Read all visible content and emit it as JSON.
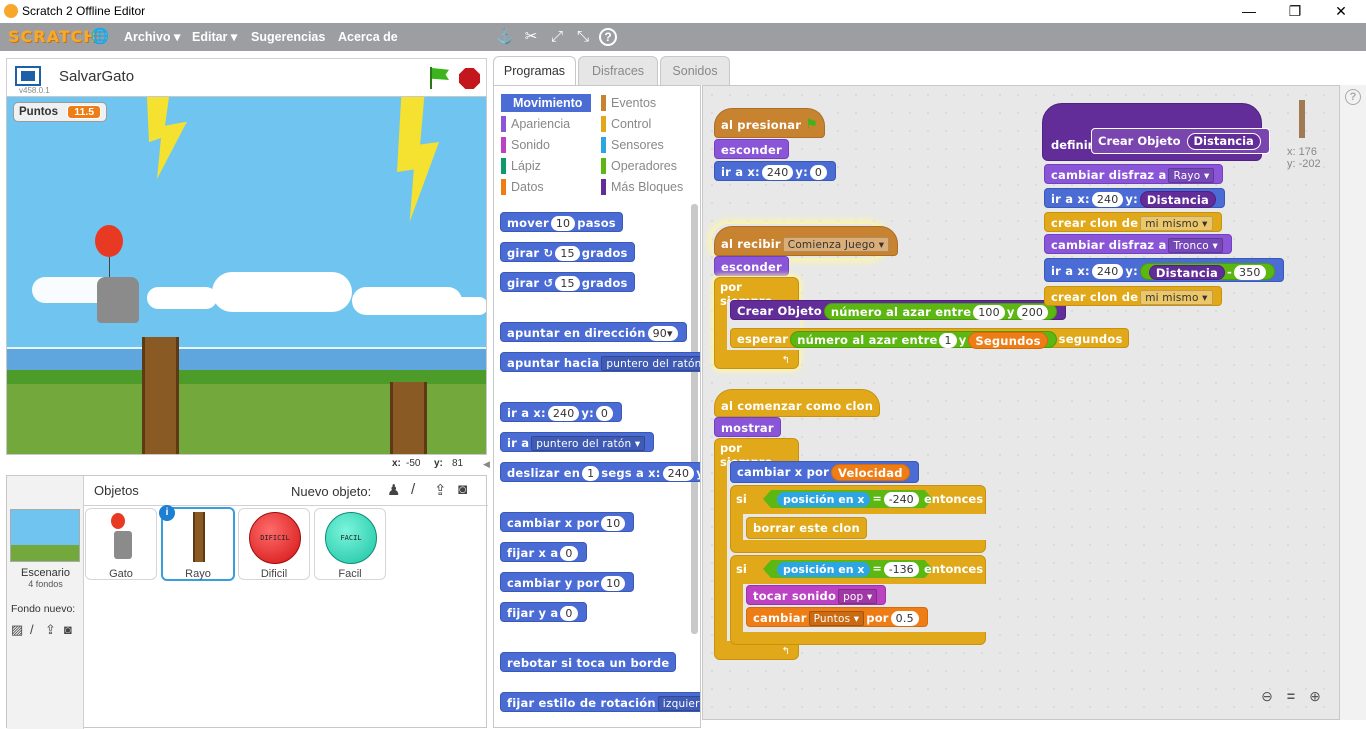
{
  "window": {
    "title": "Scratch 2 Offline Editor",
    "minimize": "—",
    "maximize": "❐",
    "close": "✕"
  },
  "menu": {
    "logo": "SCRATCH",
    "items": [
      "Archivo ▾",
      "Editar ▾",
      "Sugerencias",
      "Acerca de"
    ]
  },
  "stage": {
    "project_name": "SalvarGato",
    "version": "v458.0.1",
    "var_label": "Puntos",
    "var_value": "11.5",
    "x_label": "x:",
    "x_value": "-50",
    "y_label": "y:",
    "y_value": "81"
  },
  "sprites": {
    "header": "Objetos",
    "new_label": "Nuevo objeto:",
    "stage_label": "Escenario",
    "stage_sub": "4 fondos",
    "new_backdrop": "Fondo nuevo:",
    "items": [
      {
        "name": "Gato"
      },
      {
        "name": "Rayo"
      },
      {
        "name": "Dificil",
        "text": "DIFICIL"
      },
      {
        "name": "Facil",
        "text": "FACIL"
      }
    ]
  },
  "tabs": [
    "Programas",
    "Disfraces",
    "Sonidos"
  ],
  "categories": [
    {
      "label": "Movimiento",
      "color": "#4a6cd4"
    },
    {
      "label": "Eventos",
      "color": "#c88330"
    },
    {
      "label": "Apariencia",
      "color": "#8a55d7"
    },
    {
      "label": "Control",
      "color": "#e1a91a"
    },
    {
      "label": "Sonido",
      "color": "#bb42c3"
    },
    {
      "label": "Sensores",
      "color": "#2ca5e2"
    },
    {
      "label": "Lápiz",
      "color": "#0e9a6c"
    },
    {
      "label": "Operadores",
      "color": "#5cb712"
    },
    {
      "label": "Datos",
      "color": "#ee7d16"
    },
    {
      "label": "Más Bloques",
      "color": "#632d99"
    }
  ],
  "palette": {
    "mover": "mover",
    "mover_v": "10",
    "pasos": "pasos",
    "girar": "girar",
    "girar_v": "15",
    "grados": "grados",
    "apuntar_dir": "apuntar en dirección",
    "apuntar_dir_v": "90▾",
    "apuntar_hacia": "apuntar hacia",
    "puntero": "puntero del ratón ▾",
    "ira_x": "ir a x:",
    "ira_x_v": "240",
    "ira_y": "y:",
    "ira_y_v": "0",
    "ira": "ir a",
    "ira_v": "puntero del ratón ▾",
    "deslizar": "deslizar en",
    "deslizar_v": "1",
    "deslizar_s": "segs a x:",
    "deslizar_x": "240",
    "deslizar_y": "y",
    "cambiar_x": "cambiar x por",
    "cambiar_x_v": "10",
    "fijar_x": "fijar x a",
    "fijar_x_v": "0",
    "cambiar_y": "cambiar y por",
    "cambiar_y_v": "10",
    "fijar_y": "fijar y a",
    "fijar_y_v": "0",
    "rebotar": "rebotar si toca un borde",
    "estilo": "fijar estilo de rotación",
    "estilo_v": "izquierda-d"
  },
  "scripts": {
    "al_presionar": "al presionar",
    "esconder": "esconder",
    "ira_x": "ir a x:",
    "v240": "240",
    "y": "y:",
    "v0": "0",
    "al_recibir": "al recibir",
    "comienza": "Comienza Juego ▾",
    "por_siempre": "por siempre",
    "crear_objeto": "Crear Objeto",
    "azar": "número al azar entre",
    "v100": "100",
    "ylet": "y",
    "v200": "200",
    "esperar": "esperar",
    "v1": "1",
    "segundos_var": "Segundos",
    "segundos": "segundos",
    "al_comenzar_clon": "al comenzar como clon",
    "mostrar": "mostrar",
    "cambiar_x_por": "cambiar x por",
    "velocidad": "Velocidad",
    "si": "si",
    "posicion_x": "posición en x",
    "eq": "=",
    "m240": "-240",
    "entonces": "entonces",
    "borrar_clon": "borrar este clon",
    "m136": "-136",
    "tocar_sonido": "tocar sonido",
    "pop": "pop ▾",
    "cambiar": "cambiar",
    "puntos": "Puntos ▾",
    "por": "por",
    "v05": "0.5",
    "definir": "definir",
    "def_crear": "Crear Objeto",
    "def_dist": "Distancia",
    "cambiar_disfraz": "cambiar disfraz a",
    "rayo": "Rayo ▾",
    "tronco": "Tronco ▾",
    "distancia": "Distancia",
    "crear_clon": "crear clon de",
    "mi_mismo": "mi mismo ▾",
    "minus": "-",
    "v350": "350",
    "coord_x": "x: 176",
    "coord_y": "y: -202"
  }
}
